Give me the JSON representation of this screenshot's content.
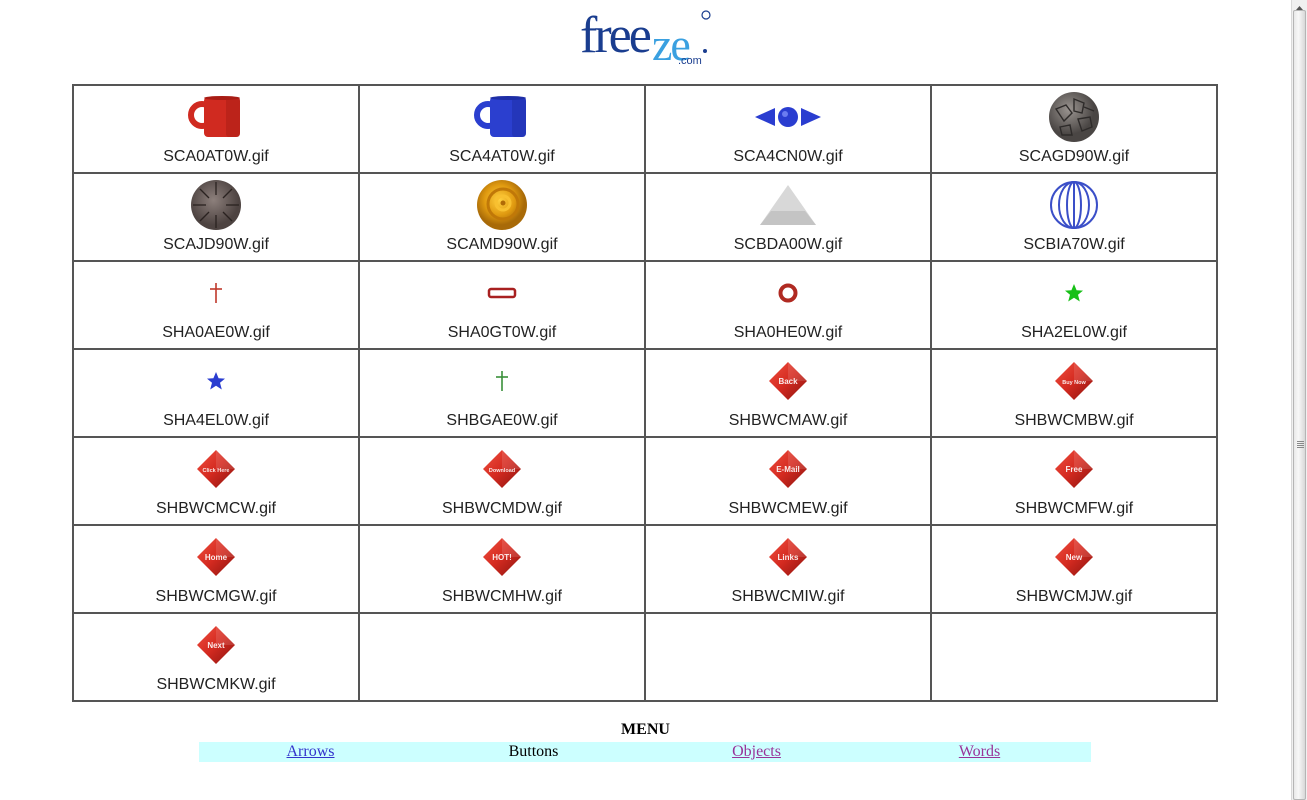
{
  "logo": {
    "text_dark": "free",
    "text_light": "ze",
    "suffix": ".com",
    "alt": "freeze.com"
  },
  "grid": {
    "rows": [
      [
        {
          "filename": "SCA0AT0W.gif",
          "icon": "red-mug-icon"
        },
        {
          "filename": "SCA4AT0W.gif",
          "icon": "blue-mug-icon"
        },
        {
          "filename": "SCA4CN0W.gif",
          "icon": "blue-arrows-ball-icon"
        },
        {
          "filename": "SCAGD90W.gif",
          "icon": "stone-ball-icon"
        }
      ],
      [
        {
          "filename": "SCAJD90W.gif",
          "icon": "segmented-stone-ball-icon"
        },
        {
          "filename": "SCAMD90W.gif",
          "icon": "gold-swirl-ball-icon"
        },
        {
          "filename": "SCBDA00W.gif",
          "icon": "gray-pyramid-icon"
        },
        {
          "filename": "SCBIA70W.gif",
          "icon": "blue-wire-sphere-icon"
        }
      ],
      [
        {
          "filename": "SHA0AE0W.gif",
          "icon": "red-cross-icon"
        },
        {
          "filename": "SHA0GT0W.gif",
          "icon": "red-bar-icon"
        },
        {
          "filename": "SHA0HE0W.gif",
          "icon": "red-ring-icon"
        },
        {
          "filename": "SHA2EL0W.gif",
          "icon": "green-star-icon"
        }
      ],
      [
        {
          "filename": "SHA4EL0W.gif",
          "icon": "blue-star-icon"
        },
        {
          "filename": "SHBGAE0W.gif",
          "icon": "green-cross-icon"
        },
        {
          "filename": "SHBWCMAW.gif",
          "icon": "red-diamond-button-icon",
          "label": "Back"
        },
        {
          "filename": "SHBWCMBW.gif",
          "icon": "red-diamond-button-icon",
          "label": "Buy Now"
        }
      ],
      [
        {
          "filename": "SHBWCMCW.gif",
          "icon": "red-diamond-button-icon",
          "label": "Click Here"
        },
        {
          "filename": "SHBWCMDW.gif",
          "icon": "red-diamond-button-icon",
          "label": "Download"
        },
        {
          "filename": "SHBWCMEW.gif",
          "icon": "red-diamond-button-icon",
          "label": "E-Mail"
        },
        {
          "filename": "SHBWCMFW.gif",
          "icon": "red-diamond-button-icon",
          "label": "Free"
        }
      ],
      [
        {
          "filename": "SHBWCMGW.gif",
          "icon": "red-diamond-button-icon",
          "label": "Home"
        },
        {
          "filename": "SHBWCMHW.gif",
          "icon": "red-diamond-button-icon",
          "label": "HOT!"
        },
        {
          "filename": "SHBWCMIW.gif",
          "icon": "red-diamond-button-icon",
          "label": "Links"
        },
        {
          "filename": "SHBWCMJW.gif",
          "icon": "red-diamond-button-icon",
          "label": "New"
        }
      ],
      [
        {
          "filename": "SHBWCMKW.gif",
          "icon": "red-diamond-button-icon",
          "label": "Next"
        },
        null,
        null,
        null
      ]
    ]
  },
  "menu": {
    "title": "MENU",
    "items": [
      {
        "label": "Arrows",
        "state": "link-unvisited"
      },
      {
        "label": "Buttons",
        "state": "current"
      },
      {
        "label": "Objects",
        "state": "link-visited"
      },
      {
        "label": "Words",
        "state": "link-visited"
      }
    ]
  },
  "colors": {
    "menu_bg": "#ccffff",
    "link_unvisited": "#3333cc",
    "link_visited": "#993399",
    "grid_border": "#555555",
    "logo_dark": "#1a3d8f",
    "logo_light": "#3aa0e0",
    "button_red": "#cc2222"
  }
}
